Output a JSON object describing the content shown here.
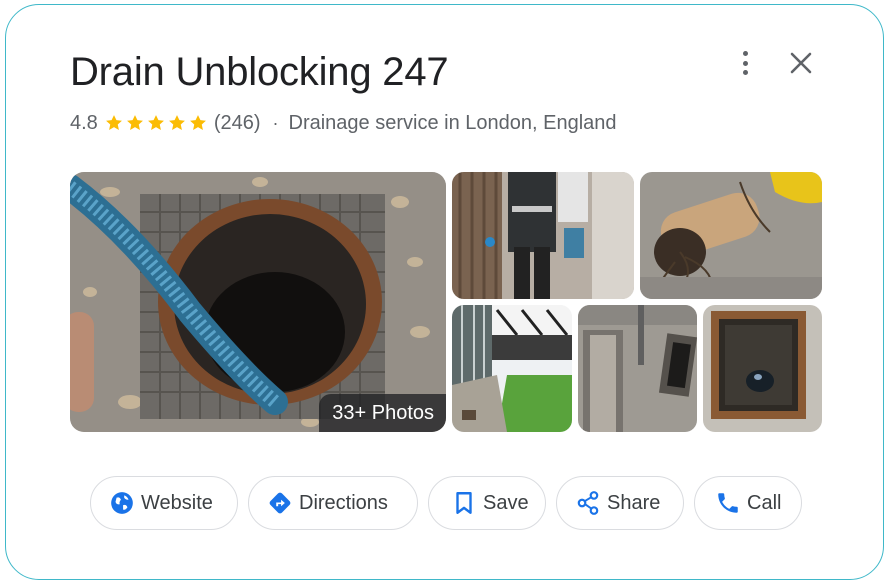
{
  "business": {
    "name": "Drain Unblocking 247",
    "rating": "4.8",
    "stars": 5,
    "reviews": "(246)",
    "separator": "·",
    "category": "Drainage service in London, England"
  },
  "photos": {
    "count_label": "33+ Photos",
    "tiles": [
      {
        "name": "photo-main-manhole-hose"
      },
      {
        "name": "photo-worker-with-bucket"
      },
      {
        "name": "photo-pipe-with-roots"
      },
      {
        "name": "photo-garden-house"
      },
      {
        "name": "photo-drain-channel"
      },
      {
        "name": "photo-inspection-chamber"
      }
    ]
  },
  "actions": {
    "website": "Website",
    "directions": "Directions",
    "save": "Save",
    "share": "Share",
    "call": "Call"
  },
  "colors": {
    "border": "#3fb8c9",
    "star": "#fbbc04",
    "action_blue": "#1a73e8",
    "text_primary": "#202124",
    "text_secondary": "#5f6368"
  },
  "icons": {
    "more": "more-vert-icon",
    "close": "close-icon",
    "website": "globe-icon",
    "directions": "directions-icon",
    "save": "bookmark-icon",
    "share": "share-icon",
    "call": "phone-icon"
  }
}
